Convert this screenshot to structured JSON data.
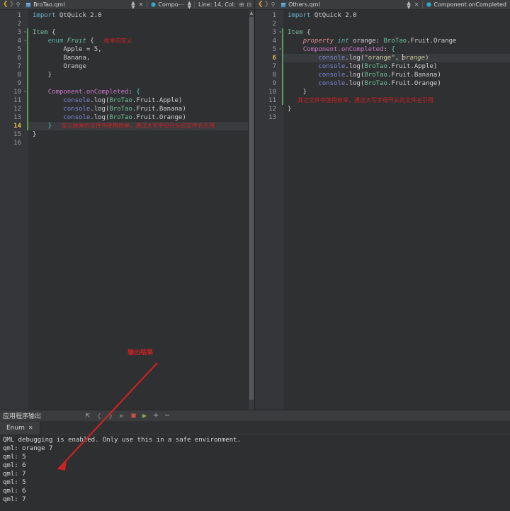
{
  "left_editor": {
    "header": {
      "nav_back_icon": "chevron-left-icon",
      "nav_forward_icon": "chevron-right-icon",
      "pin_icon": "pin-icon",
      "file_name": "BroTao.qml",
      "file_icon": "qml-file-icon",
      "split_icon": "updown-arrows-icon",
      "close_icon": "close-icon",
      "symbol_icon": "symbol-dot-icon",
      "symbol_name": "Compo⋯",
      "symbol_dropdown_icon": "updown-arrows-icon",
      "cursor_position": "Line: 14, Col:",
      "split_editor_icon": "split-editor-icon",
      "close_split_icon": "close-split-icon"
    },
    "lines": [
      {
        "n": 1,
        "fold": "",
        "changed": false,
        "current": false,
        "tokens": [
          {
            "t": "import",
            "c": "t-import"
          },
          {
            "t": " QtQuick 2.0",
            "c": "t-plain"
          }
        ]
      },
      {
        "n": 2,
        "fold": "",
        "changed": false,
        "current": false,
        "tokens": []
      },
      {
        "n": 3,
        "fold": "▾",
        "changed": true,
        "current": false,
        "tokens": [
          {
            "t": "Item",
            "c": "t-type"
          },
          {
            "t": " {",
            "c": "t-plain"
          }
        ]
      },
      {
        "n": 4,
        "fold": "▾",
        "changed": true,
        "current": false,
        "tokens": [
          {
            "t": "    ",
            "c": "t-plain"
          },
          {
            "t": "enum",
            "c": "t-enum"
          },
          {
            "t": " ",
            "c": "t-plain"
          },
          {
            "t": "Fruit",
            "c": "t-type t-italic"
          },
          {
            "t": " {",
            "c": "t-plain"
          }
        ],
        "note": "枚举的定义"
      },
      {
        "n": 5,
        "fold": "",
        "changed": true,
        "current": false,
        "tokens": [
          {
            "t": "        Apple = 5,",
            "c": "t-plain"
          }
        ]
      },
      {
        "n": 6,
        "fold": "",
        "changed": true,
        "current": false,
        "tokens": [
          {
            "t": "        Banana,",
            "c": "t-plain"
          }
        ]
      },
      {
        "n": 7,
        "fold": "",
        "changed": true,
        "current": false,
        "tokens": [
          {
            "t": "        Orange",
            "c": "t-plain"
          }
        ]
      },
      {
        "n": 8,
        "fold": "",
        "changed": true,
        "current": false,
        "tokens": [
          {
            "t": "    }",
            "c": "t-plain"
          }
        ]
      },
      {
        "n": 9,
        "fold": "",
        "changed": true,
        "current": false,
        "tokens": []
      },
      {
        "n": 10,
        "fold": "▾",
        "changed": true,
        "current": false,
        "tokens": [
          {
            "t": "    ",
            "c": "t-plain"
          },
          {
            "t": "Component.onCompleted",
            "c": "t-prop"
          },
          {
            "t": ": ",
            "c": "t-plain"
          },
          {
            "t": "{",
            "c": "t-brace"
          }
        ]
      },
      {
        "n": 11,
        "fold": "",
        "changed": true,
        "current": false,
        "tokens": [
          {
            "t": "        ",
            "c": "t-plain"
          },
          {
            "t": "console",
            "c": "t-func"
          },
          {
            "t": ".log(",
            "c": "t-plain"
          },
          {
            "t": "BroTao",
            "c": "t-obj"
          },
          {
            "t": ".Fruit.Apple)",
            "c": "t-plain"
          }
        ]
      },
      {
        "n": 12,
        "fold": "",
        "changed": true,
        "current": false,
        "tokens": [
          {
            "t": "        ",
            "c": "t-plain"
          },
          {
            "t": "console",
            "c": "t-func"
          },
          {
            "t": ".log(",
            "c": "t-plain"
          },
          {
            "t": "BroTao",
            "c": "t-obj"
          },
          {
            "t": ".Fruit.Banana)",
            "c": "t-plain"
          }
        ]
      },
      {
        "n": 13,
        "fold": "",
        "changed": true,
        "current": false,
        "tokens": [
          {
            "t": "        ",
            "c": "t-plain"
          },
          {
            "t": "console",
            "c": "t-func"
          },
          {
            "t": ".log(",
            "c": "t-plain"
          },
          {
            "t": "BroTao",
            "c": "t-obj"
          },
          {
            "t": ".Fruit.Orange)",
            "c": "t-plain"
          }
        ]
      },
      {
        "n": 14,
        "fold": "",
        "changed": true,
        "current": true,
        "tokens": [
          {
            "t": "    ",
            "c": "t-plain"
          },
          {
            "t": "}",
            "c": "t-brace"
          }
        ],
        "note": "定义枚举的文件中使用枚举，通过大写字母开头的文件名引用"
      },
      {
        "n": 15,
        "fold": "",
        "changed": false,
        "current": false,
        "tokens": [
          {
            "t": "}",
            "c": "t-plain"
          }
        ]
      },
      {
        "n": 16,
        "fold": "",
        "changed": false,
        "current": false,
        "tokens": []
      }
    ]
  },
  "right_editor": {
    "header": {
      "nav_back_icon": "chevron-left-icon",
      "nav_forward_icon": "chevron-right-icon",
      "pin_icon": "pin-icon",
      "file_name": "Others.qml",
      "file_icon": "qml-file-icon",
      "split_icon": "updown-arrows-icon",
      "close_icon": "close-icon",
      "symbol_icon": "symbol-dot-icon",
      "symbol_name": "Component.onCompleted"
    },
    "lines": [
      {
        "n": 1,
        "fold": "",
        "changed": false,
        "current": false,
        "tokens": [
          {
            "t": "import",
            "c": "t-import"
          },
          {
            "t": " QtQuick 2.0",
            "c": "t-plain"
          }
        ]
      },
      {
        "n": 2,
        "fold": "",
        "changed": false,
        "current": false,
        "tokens": []
      },
      {
        "n": 3,
        "fold": "▾",
        "changed": true,
        "current": false,
        "tokens": [
          {
            "t": "Item",
            "c": "t-type"
          },
          {
            "t": " {",
            "c": "t-plain"
          }
        ]
      },
      {
        "n": 4,
        "fold": "",
        "changed": true,
        "current": false,
        "tokens": [
          {
            "t": "    ",
            "c": "t-plain"
          },
          {
            "t": "property",
            "c": "t-kw t-italic"
          },
          {
            "t": " ",
            "c": "t-plain"
          },
          {
            "t": "int",
            "c": "t-enum t-italic"
          },
          {
            "t": " orange: ",
            "c": "t-plain"
          },
          {
            "t": "BroTao",
            "c": "t-obj"
          },
          {
            "t": ".Fruit.Orange",
            "c": "t-plain"
          }
        ]
      },
      {
        "n": 5,
        "fold": "▾",
        "changed": true,
        "current": false,
        "tokens": [
          {
            "t": "    ",
            "c": "t-plain"
          },
          {
            "t": "Component.onCompleted",
            "c": "t-prop"
          },
          {
            "t": ": ",
            "c": "t-plain"
          },
          {
            "t": "{",
            "c": "t-brace"
          }
        ]
      },
      {
        "n": 6,
        "fold": "",
        "changed": true,
        "current": true,
        "tokens": [
          {
            "t": "        ",
            "c": "t-plain"
          },
          {
            "t": "console",
            "c": "t-func"
          },
          {
            "t": ".log(",
            "c": "t-plain"
          },
          {
            "t": "\"orange\"",
            "c": "t-str"
          },
          {
            "t": ", ",
            "c": "t-plain"
          },
          {
            "t": "CARET",
            "c": "caret"
          },
          {
            "t": "orange",
            "c": "t-str t-italic"
          },
          {
            "t": ")",
            "c": "t-plain"
          }
        ]
      },
      {
        "n": 7,
        "fold": "",
        "changed": true,
        "current": false,
        "tokens": [
          {
            "t": "        ",
            "c": "t-plain"
          },
          {
            "t": "console",
            "c": "t-func"
          },
          {
            "t": ".log(",
            "c": "t-plain"
          },
          {
            "t": "BroTao",
            "c": "t-obj"
          },
          {
            "t": ".Fruit.Apple)",
            "c": "t-plain"
          }
        ]
      },
      {
        "n": 8,
        "fold": "",
        "changed": true,
        "current": false,
        "tokens": [
          {
            "t": "        ",
            "c": "t-plain"
          },
          {
            "t": "console",
            "c": "t-func"
          },
          {
            "t": ".log(",
            "c": "t-plain"
          },
          {
            "t": "BroTao",
            "c": "t-obj"
          },
          {
            "t": ".Fruit.Banana)",
            "c": "t-plain"
          }
        ]
      },
      {
        "n": 9,
        "fold": "",
        "changed": true,
        "current": false,
        "tokens": [
          {
            "t": "        ",
            "c": "t-plain"
          },
          {
            "t": "console",
            "c": "t-func"
          },
          {
            "t": ".log(",
            "c": "t-plain"
          },
          {
            "t": "BroTao",
            "c": "t-obj"
          },
          {
            "t": ".Fruit.Orange)",
            "c": "t-plain"
          }
        ]
      },
      {
        "n": 10,
        "fold": "",
        "changed": true,
        "current": false,
        "tokens": [
          {
            "t": "    }",
            "c": "t-plain"
          }
        ]
      },
      {
        "n": 11,
        "fold": "",
        "changed": true,
        "current": false,
        "tokens": [],
        "note": "其它文件中使用枚举，通过大写字母开头的文件名引用"
      },
      {
        "n": 12,
        "fold": "",
        "changed": false,
        "current": false,
        "tokens": [
          {
            "t": "}",
            "c": "t-plain"
          }
        ]
      },
      {
        "n": 13,
        "fold": "",
        "changed": false,
        "current": false,
        "tokens": []
      }
    ]
  },
  "output_panel": {
    "title": "应用程序输出",
    "toolbar_icons": [
      "word-wrap-icon",
      "prev-item-icon",
      "next-item-icon",
      "run-icon",
      "stop-icon",
      "attach-debugger-icon",
      "zoom-in-icon",
      "zoom-out-icon"
    ],
    "tab": {
      "label": "Enum",
      "close_icon": "close-icon"
    },
    "lines": [
      "QML debugging is enabled. Only use this in a safe environment.",
      "qml: orange 7",
      "qml: 5",
      "qml: 6",
      "qml: 7",
      "qml: 5",
      "qml: 6",
      "qml: 7"
    ]
  },
  "annotations": {
    "output_result_label": "输出结果",
    "arrow_color": "#cc2222"
  },
  "colors": {
    "annotation_red": "#cc2222",
    "editor_bg": "#2f3032",
    "gutter_bg": "#35363a",
    "header_bg": "#3b3c3d",
    "current_line_number": "#e8c54a",
    "change_bar_green": "#55a05a"
  }
}
